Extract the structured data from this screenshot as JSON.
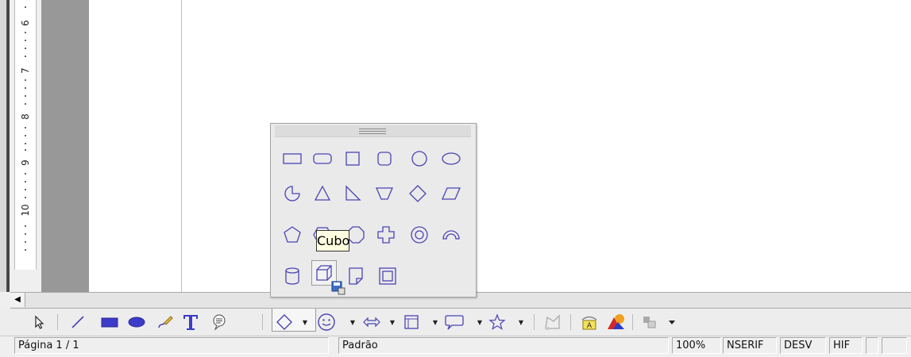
{
  "ruler": {
    "labels": [
      "6",
      "7",
      "8",
      "9",
      "10"
    ]
  },
  "scrollbar": {
    "left_arrow_glyph": "◀"
  },
  "shapes_popup": {
    "rows": [
      [
        {
          "name": "rectangle",
          "label": ""
        },
        {
          "name": "rounded-rectangle",
          "label": ""
        },
        {
          "name": "square",
          "label": ""
        },
        {
          "name": "rounded-square",
          "label": ""
        },
        {
          "name": "circle",
          "label": ""
        },
        {
          "name": "ellipse",
          "label": ""
        }
      ],
      [
        {
          "name": "circle-pie",
          "label": ""
        },
        {
          "name": "isosceles-triangle",
          "label": ""
        },
        {
          "name": "right-triangle",
          "label": ""
        },
        {
          "name": "trapezoid",
          "label": ""
        },
        {
          "name": "diamond",
          "label": ""
        },
        {
          "name": "parallelogram",
          "label": ""
        }
      ],
      [
        {
          "name": "pentagon",
          "label": ""
        },
        {
          "name": "hexagon",
          "label": ""
        },
        {
          "name": "octagon",
          "label": ""
        },
        {
          "name": "cross",
          "label": ""
        },
        {
          "name": "ring",
          "label": ""
        },
        {
          "name": "block-arc",
          "label": ""
        }
      ],
      [
        {
          "name": "cylinder",
          "label": ""
        },
        {
          "name": "cube",
          "label": ""
        },
        {
          "name": "folded-corner",
          "label": ""
        },
        {
          "name": "frame",
          "label": ""
        }
      ]
    ],
    "tooltip": "Cubo"
  },
  "toolbar": {
    "items": [
      "select",
      "line",
      "rectangle",
      "ellipse",
      "freeform-line",
      "text",
      "callout",
      "basic-shapes",
      "symbol-shapes",
      "block-arrows",
      "flowchart",
      "callouts",
      "stars",
      "points",
      "fontwork",
      "from-file",
      "extrusion"
    ]
  },
  "colors": {
    "shape_stroke": "#4a44b4",
    "shape_fill": "#3c3cc8",
    "tooltip_bg": "#ffffe1",
    "grey_area": "#989898"
  },
  "status": {
    "page": "Página 1 / 1",
    "style": "Padrão",
    "zoom": "100%",
    "insert_mode": "NSERIF",
    "selection_mode": "DESV",
    "hyphen": "HIF",
    "extra1": "",
    "extra2": ""
  }
}
